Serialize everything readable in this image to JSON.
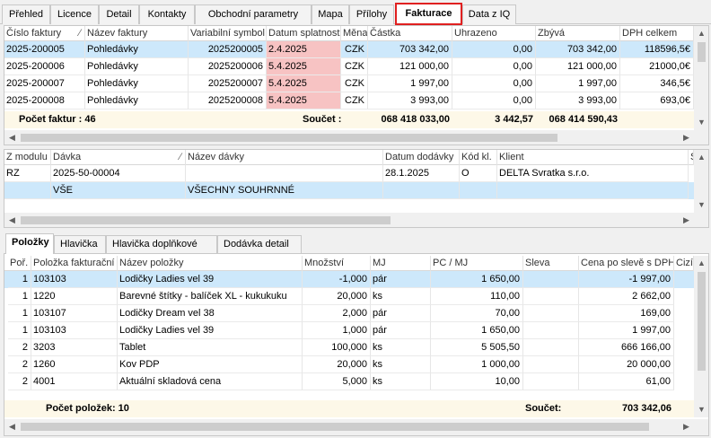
{
  "top_tabs": [
    {
      "label": "Přehled"
    },
    {
      "label": "Licence"
    },
    {
      "label": "Detail"
    },
    {
      "label": "Kontakty"
    },
    {
      "label": "Obchodní parametry"
    },
    {
      "label": "Mapa"
    },
    {
      "label": "Přílohy"
    },
    {
      "label": "Fakturace"
    },
    {
      "label": "Data z IQ"
    }
  ],
  "invoices": {
    "columns": [
      "Číslo faktury",
      "Název faktury",
      "Variabilní symbol",
      "Datum splatnosti",
      "Měna",
      "Částka",
      "Uhrazeno",
      "Zbývá",
      "DPH celkem"
    ],
    "rows": [
      [
        "2025-200005",
        "Pohledávky",
        "2025200005",
        "2.4.2025",
        "CZK",
        "703 342,00",
        "0,00",
        "703 342,00",
        "118596,5€"
      ],
      [
        "2025-200006",
        "Pohledávky",
        "2025200006",
        "5.4.2025",
        "CZK",
        "121 000,00",
        "0,00",
        "121 000,00",
        "21000,0€"
      ],
      [
        "2025-200007",
        "Pohledávky",
        "2025200007",
        "5.4.2025",
        "CZK",
        "1 997,00",
        "0,00",
        "1 997,00",
        "346,5€"
      ],
      [
        "2025-200008",
        "Pohledávky",
        "2025200008",
        "5.4.2025",
        "CZK",
        "3 993,00",
        "0,00",
        "3 993,00",
        "693,0€"
      ]
    ],
    "count_label": "Počet faktur : 46",
    "sum_label": "Součet :",
    "sum_castka": "068 418 033,00",
    "sum_uhrazeno": "3 442,57",
    "sum_zbyva": "068 414 590,43"
  },
  "batches": {
    "columns": [
      "Z modulu",
      "Dávka",
      "Název dávky",
      "Datum dodávky",
      "Kód kl.",
      "Klient",
      "S"
    ],
    "rows": [
      [
        "RZ",
        "2025-50-00004",
        "",
        "28.1.2025",
        "O",
        "DELTA Svratka s.r.o.",
        ""
      ],
      [
        "",
        "VŠE",
        "VŠECHNY SOUHRNNÉ",
        "",
        "",
        "",
        ""
      ]
    ]
  },
  "bottom_tabs": [
    {
      "label": "Položky"
    },
    {
      "label": "Hlavička"
    },
    {
      "label": "Hlavička doplňkové"
    },
    {
      "label": "Dodávka detail"
    }
  ],
  "items": {
    "columns": [
      "Poř.",
      "Položka fakturační",
      "Název položky",
      "Množství",
      "MJ",
      "PC / MJ",
      "Sleva",
      "Cena po slevě s DPH",
      "Cizí"
    ],
    "rows": [
      [
        "1",
        "103103",
        "Lodičky Ladies vel 39",
        "-1,000",
        "pár",
        "1 650,00",
        "",
        "-1 997,00"
      ],
      [
        "1",
        "1220",
        "Barevné štítky - balíček XL - kukukuku",
        "20,000",
        "ks",
        "110,00",
        "",
        "2 662,00"
      ],
      [
        "1",
        "103107",
        "Lodičky Dream vel 38",
        "2,000",
        "pár",
        "70,00",
        "",
        "169,00"
      ],
      [
        "1",
        "103103",
        "Lodičky Ladies vel 39",
        "1,000",
        "pár",
        "1 650,00",
        "",
        "1 997,00"
      ],
      [
        "2",
        "3203",
        "Tablet",
        "100,000",
        "ks",
        "5 505,50",
        "",
        "666 166,00"
      ],
      [
        "2",
        "1260",
        "Kov PDP",
        "20,000",
        "ks",
        "1 000,00",
        "",
        "20 000,00"
      ],
      [
        "2",
        "4001",
        "Aktuální skladová cena",
        "5,000",
        "ks",
        "10,00",
        "",
        "61,00"
      ]
    ],
    "count_label": "Počet položek: 10",
    "sum_label": "Součet:",
    "sum_value": "703 342,06"
  },
  "colors": {
    "selected_row": "#cde8fb",
    "overdue_date": "#f7c3c3",
    "summary_row": "#fdf8e8",
    "highlight_tab_border": "#e02020"
  }
}
